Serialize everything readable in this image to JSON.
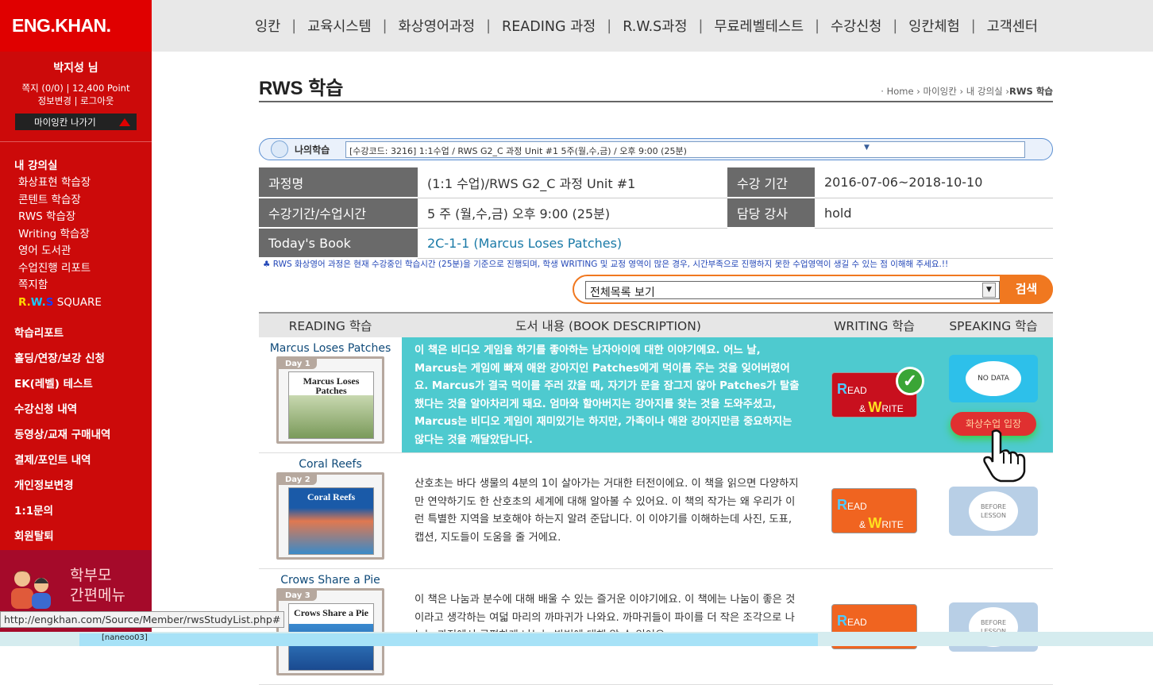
{
  "brand": {
    "logo": "ENG.KHAN."
  },
  "user": {
    "name": "박지성 님",
    "note": "쪽지 (0/0)",
    "divider": "|",
    "points": "12,400 Point",
    "edit": "정보변경",
    "logout": "로그아웃",
    "my_button": "마이잉칸 나가기"
  },
  "classroom": {
    "head": "내 강의실",
    "items": [
      "화상표현 학습장",
      "콘텐트 학습장",
      "RWS 학습장",
      "Writing 학습장",
      "영어 도서관",
      "수업진행 리포트",
      "쪽지함"
    ],
    "rws_square": {
      "r": "R.",
      "w": "W.",
      "s": "S",
      "rest": " SQUARE"
    }
  },
  "menu": [
    "학습리포트",
    "홀딩/연장/보강 신청",
    "EK(레벨) 테스트",
    "수강신청 내역",
    "동영상/교재 구매내역",
    "결제/포인트 내역",
    "개인정보변경",
    "1:1문의",
    "회원탈퇴"
  ],
  "parent_menu": {
    "line1": "학부모",
    "line2": "간편메뉴"
  },
  "topnav": [
    "잉칸",
    "교육시스템",
    "화상영어과정",
    "READING 과정",
    "R.W.S과정",
    "무료레벨테스트",
    "수강신청",
    "잉칸체험",
    "고객센터"
  ],
  "page": {
    "title": "RWS 학습",
    "breadcrumb": {
      "home": "· Home",
      "mid1": "마이잉칸",
      "mid2": "내 강의실",
      "current": "RWS 학습"
    }
  },
  "course_select": {
    "label": "나의학습",
    "value": "[수강코드: 3216] 1:1수업 / RWS G2_C 과정 Unit #1 5주(월,수,금) / 오후 9:00 (25분)"
  },
  "info": {
    "course_label": "과정명",
    "course": "(1:1 수업)/RWS G2_C 과정 Unit #1",
    "period_label": "수강 기간",
    "period": "2016-07-06~2018-10-10",
    "time_label": "수강기간/수업시간",
    "time": "5 주 (월,수,금) 오후 9:00 (25분)",
    "teacher_label": "담당 강사",
    "teacher": "hold",
    "book_label": "Today's Book",
    "book": "2C-1-1 (Marcus Loses Patches)"
  },
  "notice": "♣ RWS 화상영어 과정은 현재 수강중인 학습시간 (25분)을 기준으로 진행되며, 학생 WRITING 및 교정 영역이 많은 경우, 시간부족으로 진행하지 못한 수업영역이 생길 수 있는 점 이해해 주세요.!!",
  "search": {
    "option": "전체목록 보기",
    "button": "검색"
  },
  "table": {
    "headers": [
      "READING 학습",
      "도서 내용 (BOOK DESCRIPTION)",
      "WRITING 학습",
      "SPEAKING 학습"
    ],
    "rows": [
      {
        "title": "Marcus Loses Patches",
        "day": "Day 1",
        "cover_text": "Marcus Loses Patches",
        "description": "이 책은 비디오 게임을 하기를 좋아하는 남자아이에 대한 이야기에요. 어느 날, Marcus는 게임에 빠져 애완 강아지인 Patches에게 먹이를 주는 것을 잊어버렸어요. Marcus가 결국 먹이를 주러 갔을 때, 자기가 문을 잠그지 않아 Patches가 탈출했다는 것을 알아차리게 돼요. 엄마와 할아버지는 강아지를 찾는 것을 도와주셨고, Marcus는 비디오 게임이 재미있기는 하지만, 가족이나 애완 강아지만큼 중요하지는 않다는 것을 깨달았답니다.",
        "speaking": "NO DATA",
        "enter": "화상수업 입장"
      },
      {
        "title": "Coral Reefs",
        "day": "Day 2",
        "cover_text": "Coral Reefs",
        "description": "산호초는 바다 생물의 4분의 1이 살아가는 거대한 터전이에요. 이 책을 읽으면 다양하지만 연약하기도 한 산호초의 세계에 대해 알아볼 수 있어요. 이 책의 작가는 왜 우리가 이런 특별한 지역을 보호해야 하는지 알려 준답니다. 이 이야기를 이해하는데 사진, 도표, 캡션, 지도들이 도움을 줄 거에요.",
        "speaking": "BEFORE LESSON"
      },
      {
        "title": "Crows Share a Pie",
        "day": "Day 3",
        "cover_text": "Crows Share a Pie",
        "description": "이 책은 나눔과 분수에 대해 배울 수 있는 즐거운 이야기에요. 이 책에는 나눔이 좋은 것이라고 생각하는 여덟 마리의 까마귀가 나와요. 까마귀들이 파이를 더 작은 조각으로 나누는 과정에서 공평하게 나누는 방법에 대해 알 수 있어요.",
        "speaking": "BEFORE LESSON"
      }
    ],
    "rw_read": "EAD",
    "rw_write": "RITE",
    "rw_R": "R",
    "rw_W": "W",
    "rw_amp": "&"
  },
  "status_url": "http://engkhan.com/Source/Member/rwsStudyList.php#",
  "bottom_small": "[naneoo03]"
}
